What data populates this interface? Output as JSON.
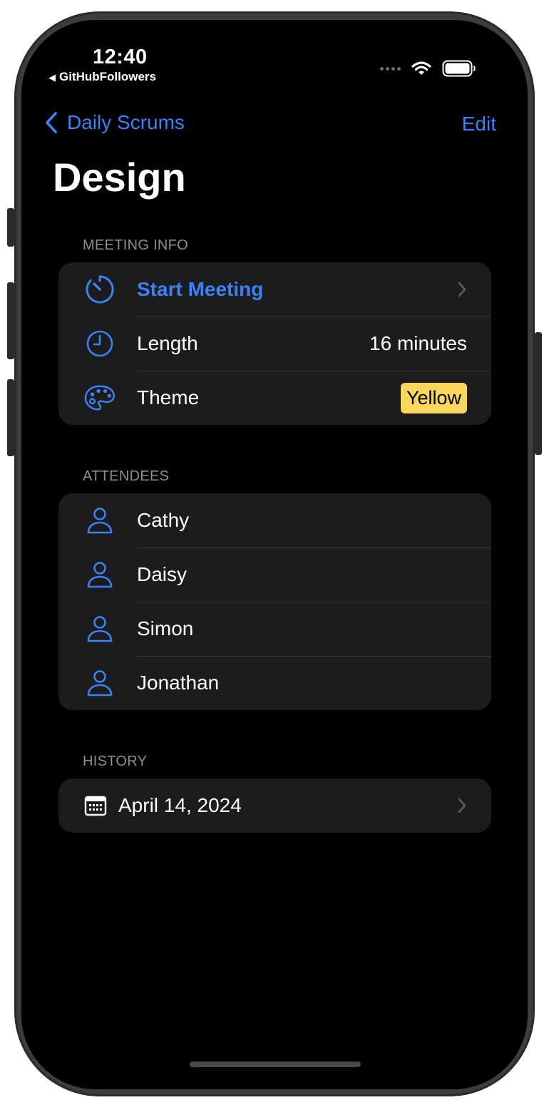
{
  "status_bar": {
    "time": "12:40",
    "back_app": "GitHubFollowers"
  },
  "nav": {
    "back_label": "Daily Scrums",
    "edit_label": "Edit"
  },
  "title": "Design",
  "meeting_info": {
    "header": "MEETING INFO",
    "start_label": "Start Meeting",
    "length_label": "Length",
    "length_value": "16 minutes",
    "theme_label": "Theme",
    "theme_value": "Yellow"
  },
  "attendees": {
    "header": "ATTENDEES",
    "names": [
      "Cathy",
      "Daisy",
      "Simon",
      "Jonathan"
    ]
  },
  "history": {
    "header": "HISTORY",
    "items": [
      "April 14, 2024"
    ]
  },
  "colors": {
    "accent": "#3b82f6",
    "theme_badge": "#f9d65c",
    "card_bg": "#1c1c1e",
    "secondary_text": "#8e8e93"
  },
  "icons": {
    "start": "timer-icon",
    "length": "clock-icon",
    "theme": "palette-icon",
    "attendee": "person-icon",
    "history": "calendar-icon",
    "disclosure": "chevron-right-icon"
  }
}
